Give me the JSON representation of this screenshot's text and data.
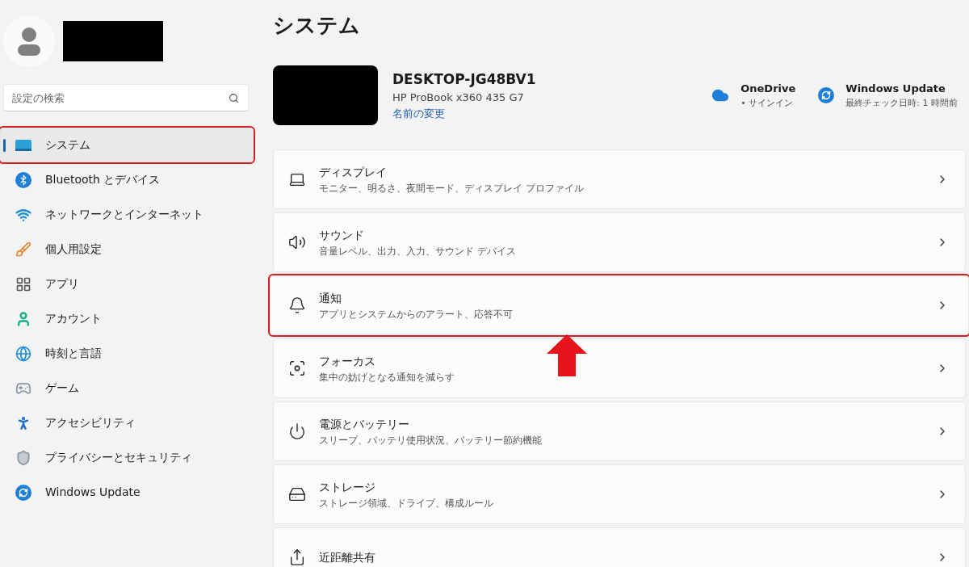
{
  "sidebar": {
    "search": {
      "placeholder": "設定の検索"
    },
    "items": [
      {
        "label": "システム",
        "kind": "system",
        "selected": true,
        "highlighted": true
      },
      {
        "label": "Bluetooth とデバイス",
        "kind": "bluetooth",
        "selected": false,
        "highlighted": false
      },
      {
        "label": "ネットワークとインターネット",
        "kind": "wifi",
        "selected": false,
        "highlighted": false
      },
      {
        "label": "個人用設定",
        "kind": "brush",
        "selected": false,
        "highlighted": false
      },
      {
        "label": "アプリ",
        "kind": "apps",
        "selected": false,
        "highlighted": false
      },
      {
        "label": "アカウント",
        "kind": "account",
        "selected": false,
        "highlighted": false
      },
      {
        "label": "時刻と言語",
        "kind": "time",
        "selected": false,
        "highlighted": false
      },
      {
        "label": "ゲーム",
        "kind": "game",
        "selected": false,
        "highlighted": false
      },
      {
        "label": "アクセシビリティ",
        "kind": "access",
        "selected": false,
        "highlighted": false
      },
      {
        "label": "プライバシーとセキュリティ",
        "kind": "shield",
        "selected": false,
        "highlighted": false
      },
      {
        "label": "Windows Update",
        "kind": "update",
        "selected": false,
        "highlighted": false
      }
    ]
  },
  "page_title": "システム",
  "device": {
    "name": "DESKTOP-JG48BV1",
    "model": "HP ProBook x360 435 G7",
    "rename_link": "名前の変更"
  },
  "status": [
    {
      "kind": "cloud",
      "title": "OneDrive",
      "detail": "• サインイン"
    },
    {
      "kind": "update",
      "title": "Windows Update",
      "detail": "最終チェック日時: 1 時間前"
    }
  ],
  "cards": [
    {
      "kind": "display",
      "title": "ディスプレイ",
      "subtitle": "モニター、明るさ、夜間モード、ディスプレイ プロファイル",
      "highlighted": false
    },
    {
      "kind": "sound",
      "title": "サウンド",
      "subtitle": "音量レベル、出力、入力、サウンド デバイス",
      "highlighted": false
    },
    {
      "kind": "bell",
      "title": "通知",
      "subtitle": "アプリとシステムからのアラート、応答不可",
      "highlighted": true
    },
    {
      "kind": "focus",
      "title": "フォーカス",
      "subtitle": "集中の妨げとなる通知を減らす",
      "highlighted": false
    },
    {
      "kind": "power",
      "title": "電源とバッテリー",
      "subtitle": "スリープ、バッテリ使用状況、バッテリー節約機能",
      "highlighted": false
    },
    {
      "kind": "storage",
      "title": "ストレージ",
      "subtitle": "ストレージ領域、ドライブ、構成ルール",
      "highlighted": false
    },
    {
      "kind": "share",
      "title": "近距離共有",
      "highlighted": false
    }
  ]
}
